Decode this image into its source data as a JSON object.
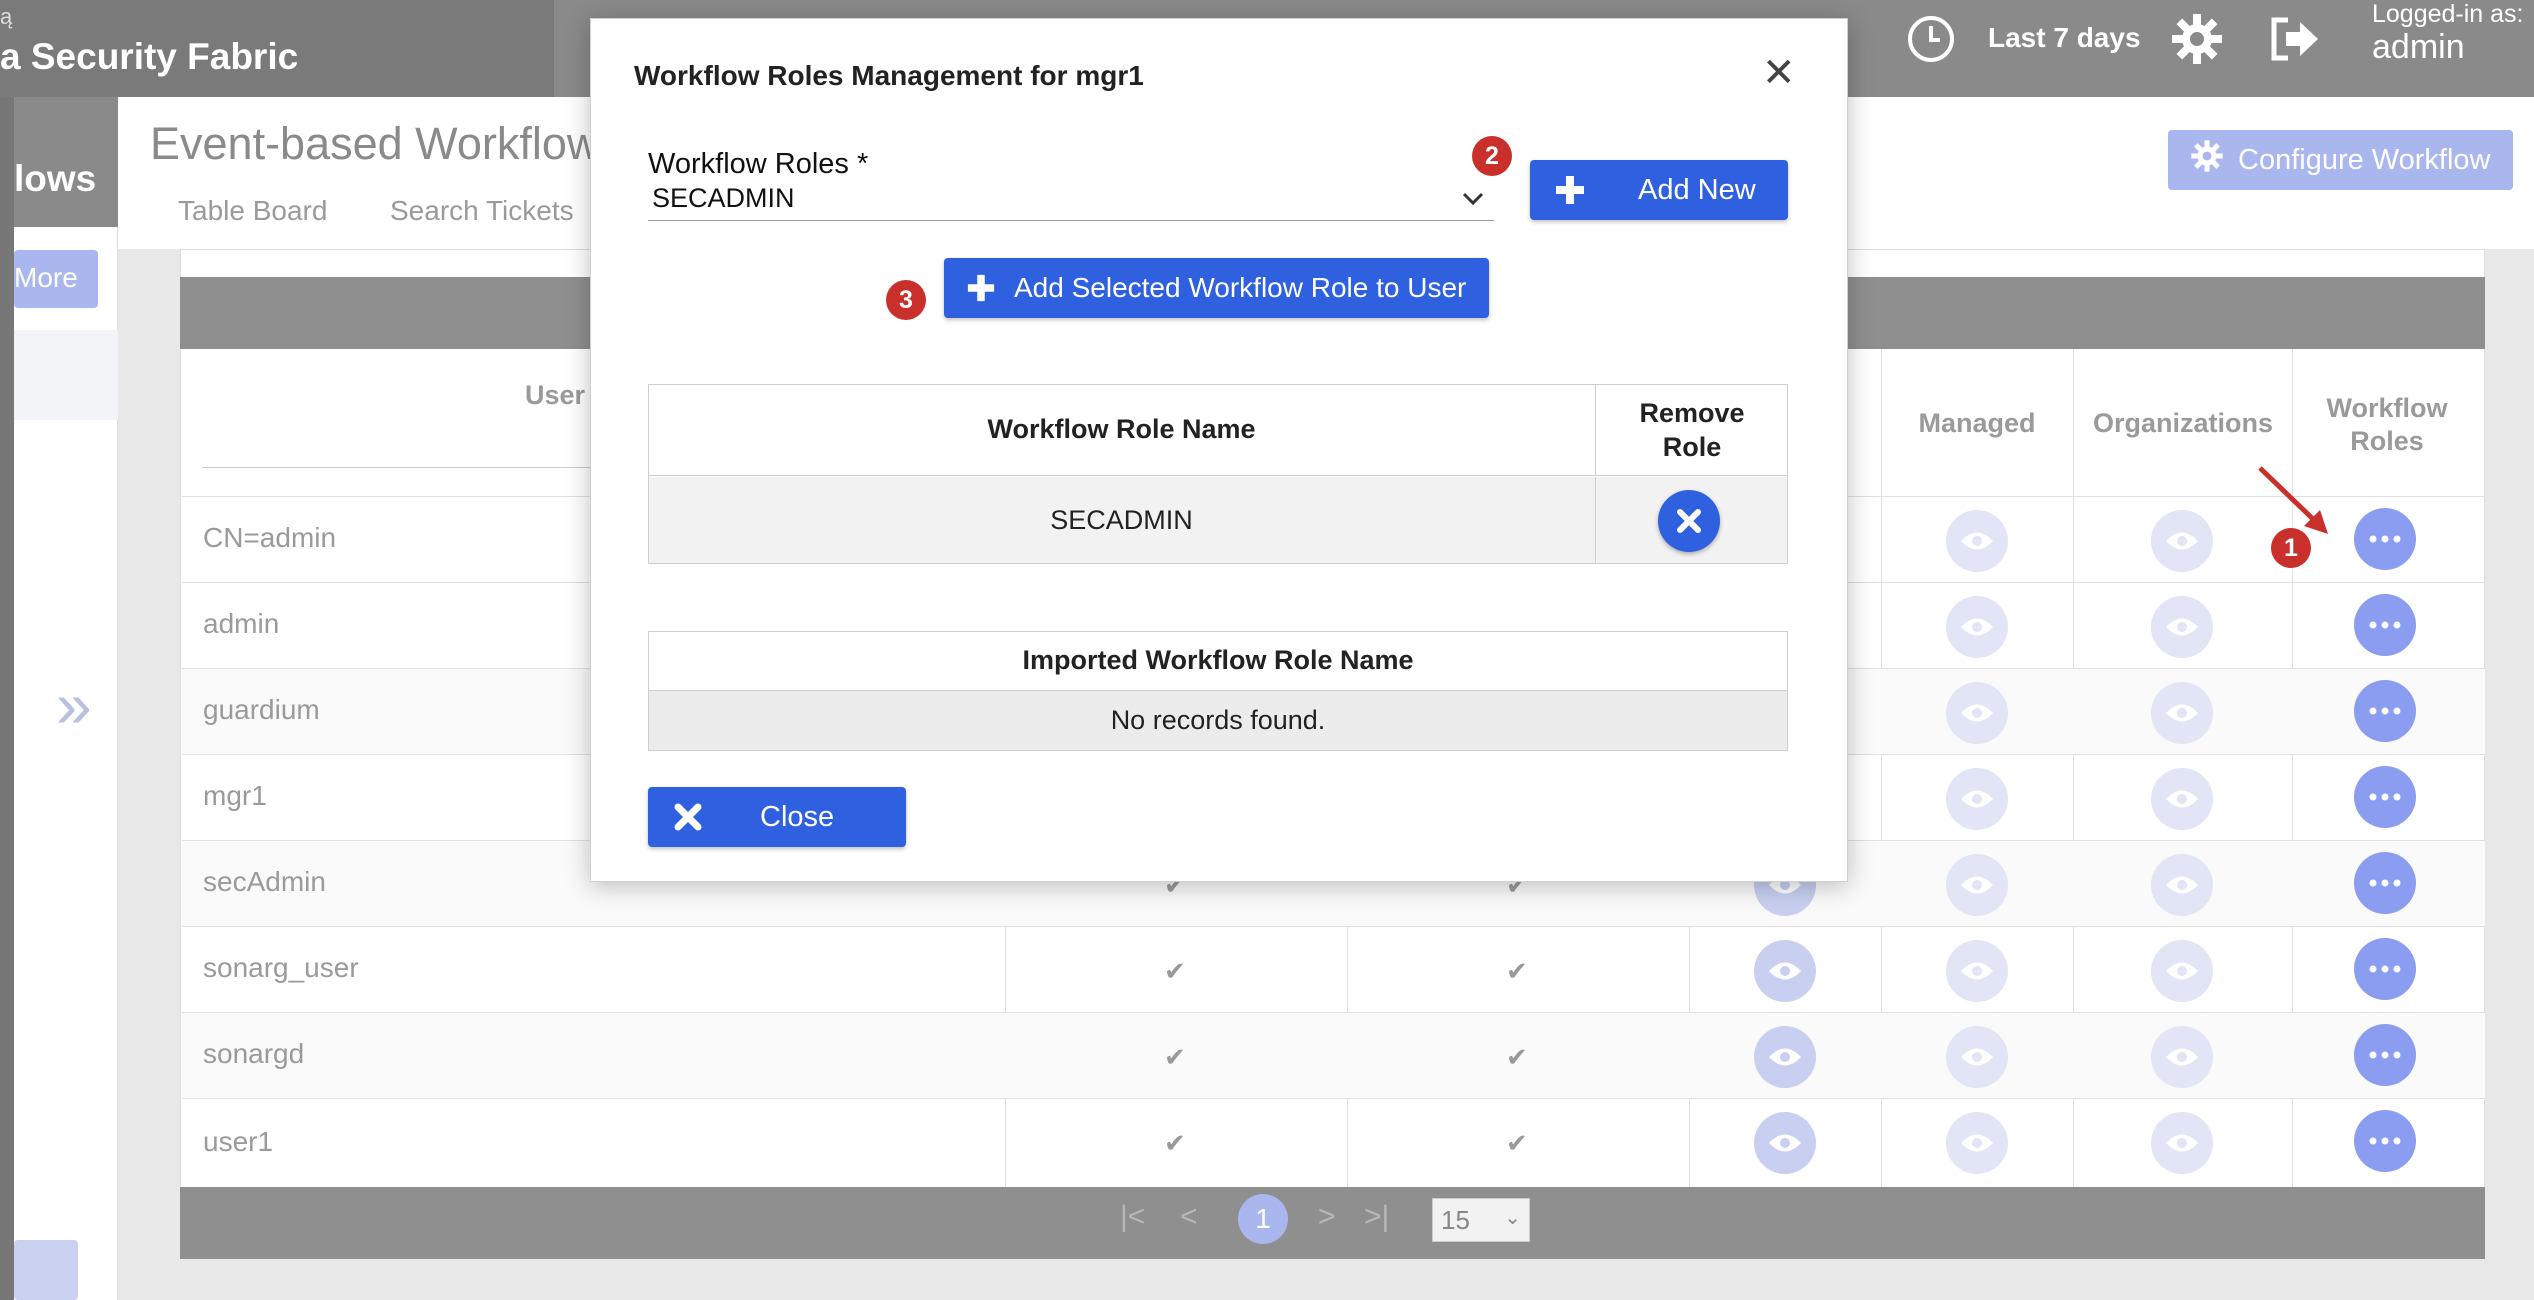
{
  "app": {
    "brand_top": "ą",
    "brand_name": "a Security Fabric",
    "time_range": "Last 7 days",
    "logged_in_label": "Logged-in as:",
    "logged_in_user": "admin",
    "side_title": "lows",
    "more_button": "More"
  },
  "page": {
    "title": "Event-based Workflow",
    "tabs": [
      "Table Board",
      "Search Tickets"
    ],
    "configure_button": "Configure Workflow"
  },
  "table": {
    "columns": {
      "user": "User",
      "managed": "Managed",
      "organizations": "Organizations",
      "workflow_roles_1": "Workflow",
      "workflow_roles_2": "Roles"
    },
    "rows": [
      "CN=admin",
      "admin",
      "guardium",
      "mgr1",
      "secAdmin",
      "sonarg_user",
      "sonargd",
      "user1"
    ],
    "pagination": {
      "current_page": "1",
      "page_size": "15"
    }
  },
  "modal": {
    "title": "Workflow Roles Management for mgr1",
    "roles_label": "Workflow Roles *",
    "roles_selected": "SECADMIN",
    "add_new_button": "Add New",
    "add_selected_button": "Add Selected Workflow Role to User",
    "roles_table": {
      "col_name": "Workflow Role Name",
      "col_remove_1": "Remove",
      "col_remove_2": "Role",
      "rows": [
        "SECADMIN"
      ]
    },
    "imported_table": {
      "col_name": "Imported Workflow Role Name",
      "empty_text": "No records found."
    },
    "close_button": "Close"
  },
  "annotations": {
    "badge1": "1",
    "badge2": "2",
    "badge3": "3"
  },
  "colors": {
    "primary": "#2f60e0",
    "badge": "#c9302c",
    "topbar": "#8a8a8a"
  },
  "icons": [
    "clock-icon",
    "gear-icon",
    "logout-icon",
    "close-icon",
    "chevron-down-icon",
    "plus-icon",
    "times-circle-icon",
    "eye-icon",
    "ellipsis-icon",
    "check-icon",
    "double-chevron-right-icon",
    "arrow-icon"
  ]
}
